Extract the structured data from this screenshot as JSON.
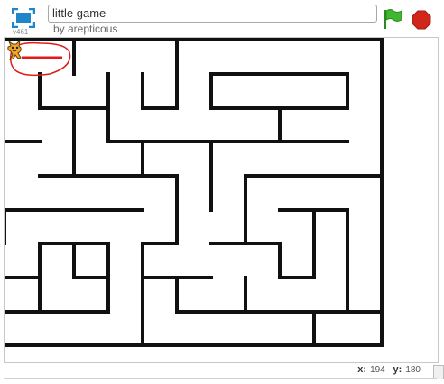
{
  "header": {
    "version": "v461",
    "project_title": "little game",
    "author_line": "by arepticous"
  },
  "icons": {
    "fullscreen": "fullscreen-icon",
    "green_flag": "green-flag-icon",
    "stop": "stop-icon"
  },
  "colors": {
    "accent_blue": "#1f86c9",
    "flag_green": "#3fb72e",
    "stop_red": "#d0261b",
    "annotation_red": "#e21a1a",
    "maze_wall": "#111111"
  },
  "status": {
    "x_label": "x:",
    "x_value": "194",
    "y_label": "y:",
    "y_value": "180"
  }
}
